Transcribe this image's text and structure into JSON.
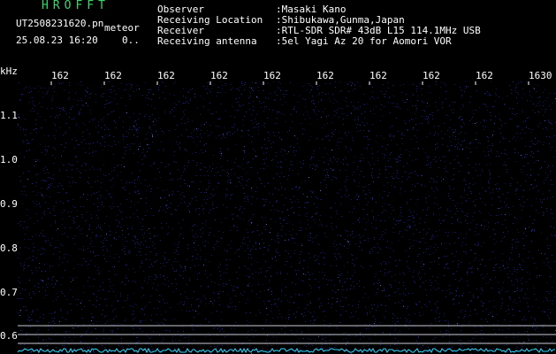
{
  "header": {
    "app_title": "HROFFT",
    "file_name": "UT2508231620.pn",
    "mode": "meteor",
    "date_time": "25.08.23 16:20",
    "value_readout": "0.."
  },
  "meta": [
    {
      "label": "Observer",
      "value": ":Masaki Kano"
    },
    {
      "label": "Receiving Location",
      "value": ":Shibukawa,Gunma,Japan"
    },
    {
      "label": "Receiver",
      "value": ":RTL-SDR SDR# 43dB L15 114.1MHz USB"
    },
    {
      "label": "Receiving antenna",
      "value": ":5el Yagi Az 20 for Aomori VOR"
    }
  ],
  "axes": {
    "y_unit": "kHz",
    "x_ticks": [
      "162",
      "162",
      "162",
      "162",
      "162",
      "162",
      "162",
      "162",
      "162",
      "1630"
    ],
    "y_ticks": [
      "1.1",
      "1.0",
      "0.9",
      "0.8",
      "0.7",
      "0.6"
    ]
  },
  "colors": {
    "background": "#000000",
    "noise": "#1a22a8",
    "reference_line": "#c9cbd6",
    "spectrum_trace": "#2ad8ff",
    "title_green": "#37d86a"
  }
}
